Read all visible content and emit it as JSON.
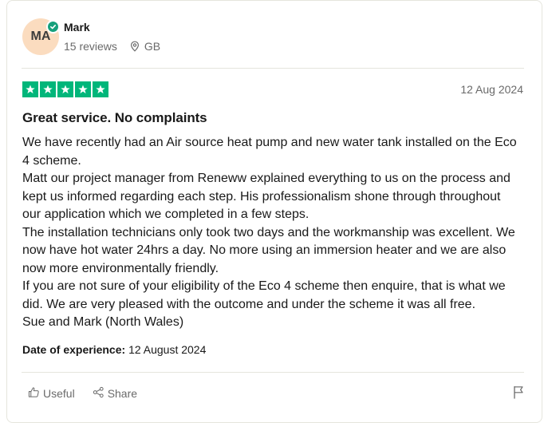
{
  "reviewer": {
    "initials": "MA",
    "name": "Mark",
    "reviews_count": "15 reviews",
    "country": "GB"
  },
  "review": {
    "rating": 5,
    "date": "12 Aug 2024",
    "title": "Great service. No complaints",
    "paragraphs": [
      "We have recently had an Air source heat pump and new water tank installed on the Eco 4 scheme.",
      "Matt our project manager from Reneww explained everything to us on the process and kept us informed regarding each step. His professionalism shone through throughout our application which we completed in a few steps.",
      "The installation technicians only took two days and the workmanship was excellent. We now have hot water 24hrs a day. No more using an immersion heater and we are also now more environmentally friendly.",
      "If you are not sure of your eligibility of the Eco 4 scheme then enquire, that is what we did. We are very pleased with the outcome and under the scheme it was all free.",
      "Sue and Mark (North Wales)"
    ],
    "experience_label": "Date of experience:",
    "experience_date": "12 August 2024"
  },
  "actions": {
    "useful_label": "Useful",
    "share_label": "Share"
  },
  "colors": {
    "star_green": "#00b67a",
    "verified_green": "#16a07c",
    "avatar_bg": "#fbdcbf"
  },
  "icons": [
    "verified-check-icon",
    "location-pin-icon",
    "star-icon",
    "thumbs-up-icon",
    "share-icon",
    "flag-icon"
  ]
}
